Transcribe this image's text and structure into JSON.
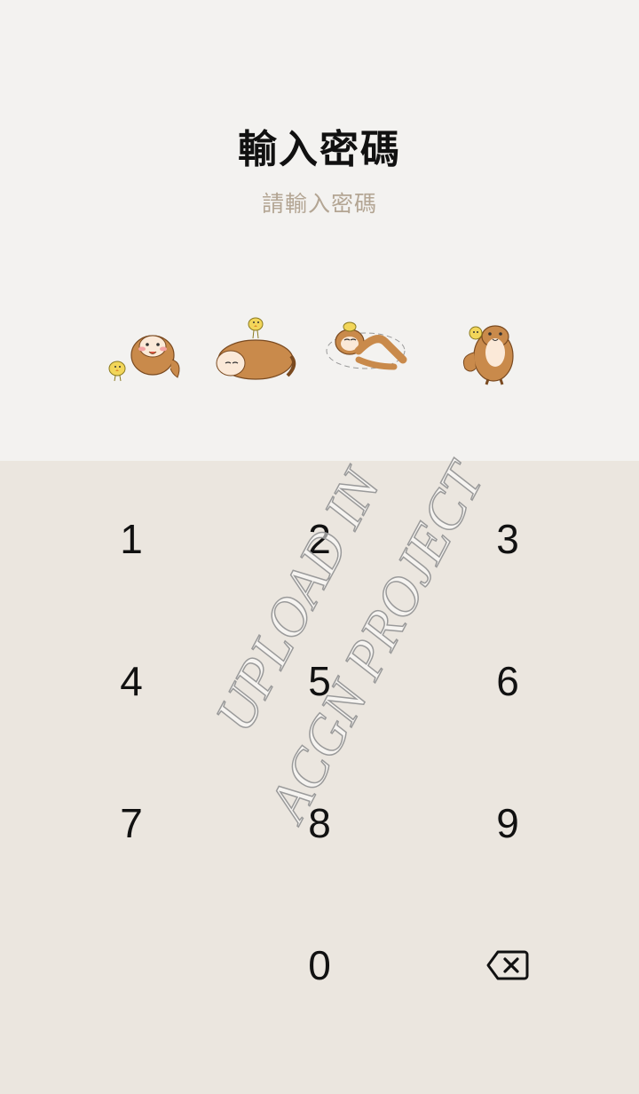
{
  "header": {
    "title": "輸入密碼",
    "subtitle": "請輸入密碼"
  },
  "pin_indicators": [
    {
      "icon": "otter-with-chick-icon",
      "filled": false
    },
    {
      "icon": "otter-lying-with-chick-icon",
      "filled": false
    },
    {
      "icon": "otter-rolling-icon",
      "filled": false
    },
    {
      "icon": "otter-holding-chick-icon",
      "filled": false
    }
  ],
  "keypad": {
    "keys": [
      "1",
      "2",
      "3",
      "4",
      "5",
      "6",
      "7",
      "8",
      "9",
      "0"
    ],
    "backspace_icon": "backspace-icon"
  },
  "watermark": {
    "line1": "UPLOAD IN",
    "line2": "ACGN PROJECT"
  },
  "colors": {
    "top_background": "#f3f2f0",
    "keypad_background": "#ebe6df",
    "subtitle": "#b3a593",
    "otter": "#c98a4b",
    "chick": "#f2d65a"
  }
}
